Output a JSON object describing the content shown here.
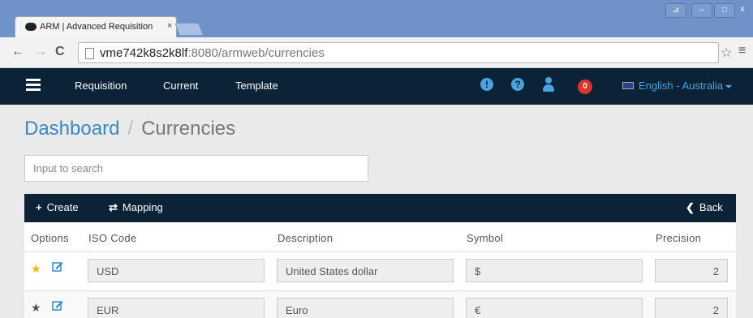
{
  "browser": {
    "tab_title": "ARM | Advanced Requisition",
    "tab_close": "×",
    "url_host": "vme742k8s2k8lf",
    "url_rest": ":8080/armweb/currencies",
    "win_minimize": "‒",
    "win_maximize": "□",
    "win_close": "x",
    "win_ctl0": "⊿"
  },
  "nav": {
    "links": [
      "Requisition",
      "Current",
      "Template"
    ],
    "alert_icon": "!",
    "help_icon": "?",
    "badge_count": "0",
    "language": "English - Australia"
  },
  "breadcrumb": {
    "root": "Dashboard",
    "separator": "/",
    "current": "Currencies"
  },
  "search": {
    "placeholder": "Input to search"
  },
  "actions": {
    "create_icon": "+",
    "create_label": "Create",
    "mapping_icon": "⇄",
    "mapping_label": "Mapping",
    "back_icon": "❮",
    "back_label": "Back"
  },
  "table": {
    "headers": [
      "Options",
      "ISO Code",
      "Description",
      "Symbol",
      "Precision"
    ],
    "rows": [
      {
        "iso": "USD",
        "description": "United States dollar",
        "symbol": "$",
        "precision": "2",
        "default": true
      },
      {
        "iso": "EUR",
        "description": "Euro",
        "symbol": "€",
        "precision": "2",
        "default": false
      }
    ]
  },
  "colors": {
    "navbar": "#0b2237",
    "accent": "#4aa3df",
    "badge": "#d9362b",
    "star_default": "#f0b400",
    "star_inactive": "#555555"
  }
}
